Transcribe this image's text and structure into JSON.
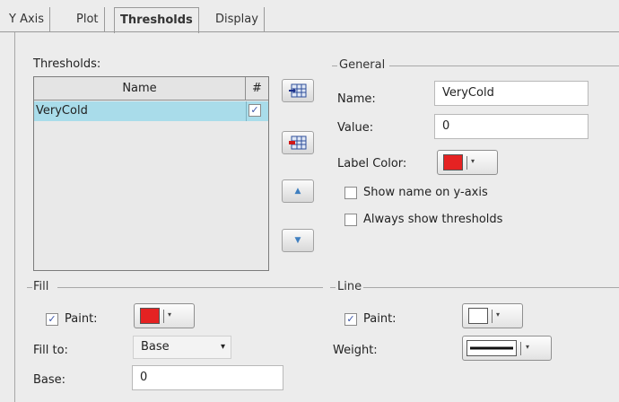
{
  "tabs": [
    {
      "label": "Y Axis",
      "active": false
    },
    {
      "label": "Plot",
      "active": false
    },
    {
      "label": "Thresholds",
      "active": true
    },
    {
      "label": "Display",
      "active": false
    }
  ],
  "thresholds": {
    "label": "Thresholds:",
    "columns": [
      "Name",
      "#"
    ],
    "rows": [
      {
        "name": "VeryCold",
        "checked": true,
        "checkmark": "✓"
      }
    ],
    "buttons": [
      "add-threshold-icon",
      "remove-threshold-icon",
      "move-up-icon",
      "move-down-icon"
    ]
  },
  "general": {
    "title": "General",
    "name_label": "Name:",
    "name_value": "VeryCold",
    "value_label": "Value:",
    "value_value": "0",
    "label_color_label": "Label Color:",
    "label_color": "#e52222",
    "show_name_label": "Show name on y-axis",
    "show_name_checked": false,
    "always_show_label": "Always show thresholds",
    "always_show_checked": false
  },
  "fill": {
    "title": "Fill",
    "paint_label": "Paint:",
    "paint_checked": true,
    "checkmark": "✓",
    "paint_color": "#e52222",
    "fill_to_label": "Fill to:",
    "fill_to_value": "Base",
    "base_label": "Base:",
    "base_value": "0"
  },
  "line": {
    "title": "Line",
    "paint_label": "Paint:",
    "paint_checked": true,
    "checkmark": "✓",
    "paint_color": "#ffffff",
    "weight_label": "Weight:"
  },
  "icons": {
    "dropdown_arrow": "▾",
    "up_arrow": "▲",
    "down_arrow": "▼"
  }
}
